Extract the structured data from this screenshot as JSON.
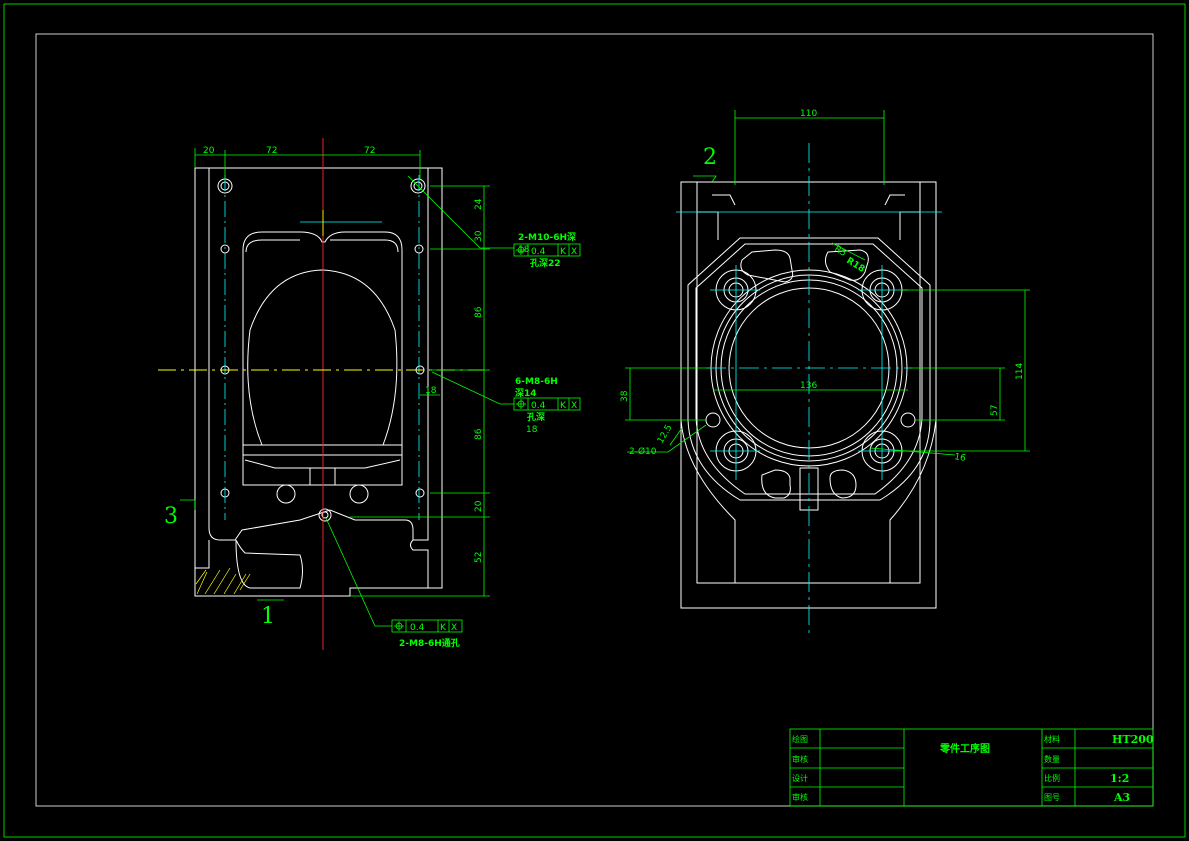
{
  "views": {
    "left": {
      "dims_top": [
        "20",
        "72",
        "72"
      ],
      "dims_right": [
        "24",
        "30",
        "86",
        "86",
        "20",
        "52"
      ],
      "dim_18_small": "18",
      "callout_m10": {
        "line1": "2-M10-6H深",
        "line2": "孔深22",
        "extra": "18",
        "tol": "0.4",
        "ref1": "K",
        "ref2": "X"
      },
      "callout_m8": {
        "line1": "6-M8-6H",
        "line2": "深14",
        "line3": "孔深",
        "line4": "18",
        "tol": "0.4",
        "ref1": "K",
        "ref2": "X"
      },
      "callout_bottom": {
        "line1": "2-M8-6H通孔",
        "tol": "0.4",
        "ref1": "K",
        "ref2": "X"
      },
      "labels": {
        "one": "1",
        "three": "3"
      }
    },
    "right": {
      "dim_110": "110",
      "dim_136": "136",
      "dim_114": "114",
      "dim_57": "57",
      "dim_38": "38",
      "dim_12_5": "12.5",
      "dim_phi10": "2-Ø10",
      "dim_r": "R18",
      "dim_r2": "R5",
      "dim_16": "16",
      "label_two": "2"
    }
  },
  "title_block": {
    "left_labels": [
      "绘图",
      "审核",
      "设计",
      "审核"
    ],
    "title": "零件工序图",
    "material_label": "材料",
    "material_value": "HT200",
    "row2_label": "数量",
    "scale_label": "比例",
    "scale_value": "1:2",
    "sheet_label": "图号",
    "sheet_value": "A3"
  },
  "colors": {
    "background": "#000000",
    "outline": "#ffffff",
    "dimension": "#00ff00",
    "center": "#00ffff",
    "axis_red": "#ff2a2a",
    "axis_yellow": "#ffff00"
  }
}
